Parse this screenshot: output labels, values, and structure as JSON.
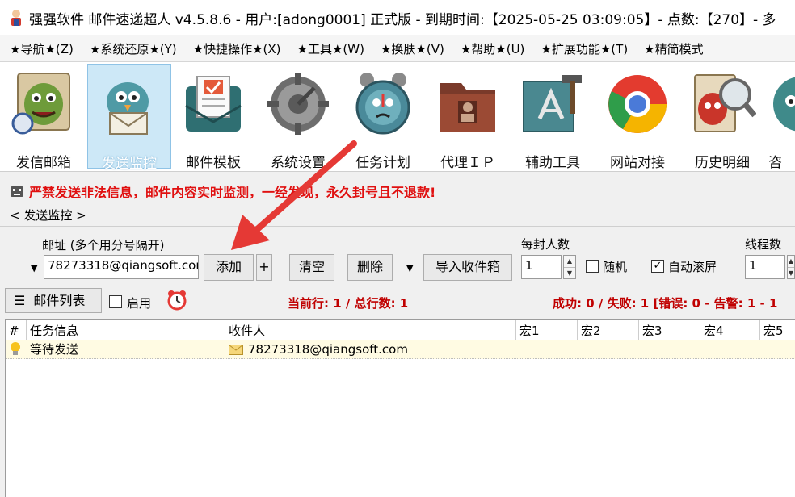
{
  "window": {
    "title": "强强软件 邮件速递超人 v4.5.8.6 - 用户:[adong0001] 正式版 - 到期时间:【2025-05-25 03:09:05】- 点数:【270】- 多"
  },
  "menu": {
    "items": [
      "★导航★(Z)",
      "★系统还原★(Y)",
      "★快捷操作★(X)",
      "★工具★(W)",
      "★换肤★(V)",
      "★帮助★(U)",
      "★扩展功能★(T)",
      "★精简模式"
    ]
  },
  "toolbar": {
    "tools": [
      {
        "label": "发信邮箱",
        "icon": "mailbox-monster-icon"
      },
      {
        "label": "发送监控",
        "icon": "bird-envelope-icon",
        "active": true
      },
      {
        "label": "邮件模板",
        "icon": "mail-template-icon"
      },
      {
        "label": "系统设置",
        "icon": "gear-icon"
      },
      {
        "label": "任务计划",
        "icon": "alarm-clock-icon"
      },
      {
        "label": "代理ＩＰ",
        "icon": "proxy-folder-icon"
      },
      {
        "label": "辅助工具",
        "icon": "tools-icon"
      },
      {
        "label": "网站对接",
        "icon": "browser-icon"
      },
      {
        "label": "历史明细",
        "icon": "history-icon"
      },
      {
        "label": "咨",
        "icon": "consult-icon"
      }
    ]
  },
  "warning": {
    "text": "严禁发送非法信息，邮件内容实时监测，一经发现，永久封号且不退款!"
  },
  "section": {
    "title": "< 发送监控 >"
  },
  "form": {
    "address_label": "邮址 (多个用分号隔开)",
    "address_value": "78273318@qiangsoft.com",
    "add_button": "添加",
    "plus_button": "+",
    "clear_button": "清空",
    "delete_button": "删除",
    "import_button": "导入收件箱",
    "per_mail_label": "每封人数",
    "per_mail_value": "1",
    "random_label": "随机",
    "random_checked": false,
    "autoscroll_label": "自动滚屏",
    "autoscroll_checked": true,
    "threads_label": "线程数",
    "threads_value": "1"
  },
  "statusbar": {
    "list_button": "邮件列表",
    "enable_label": "启用",
    "enable_checked": false,
    "current_line": "当前行: 1 / 总行数: 1",
    "results": "成功: 0 / 失败: 1 [错误: 0 - 告警: 1 - 1"
  },
  "grid": {
    "columns": [
      "#",
      "任务信息",
      "收件人",
      "宏1",
      "宏2",
      "宏3",
      "宏4",
      "宏5"
    ],
    "rows": [
      {
        "status": "等待发送",
        "recipient": "78273318@qiangsoft.com"
      }
    ]
  },
  "colors": {
    "warning": "#e01010",
    "status": "#c00000",
    "active_tool": "#cde8f7",
    "row_highlight": "#fffbe3",
    "arrow": "#e53935"
  }
}
